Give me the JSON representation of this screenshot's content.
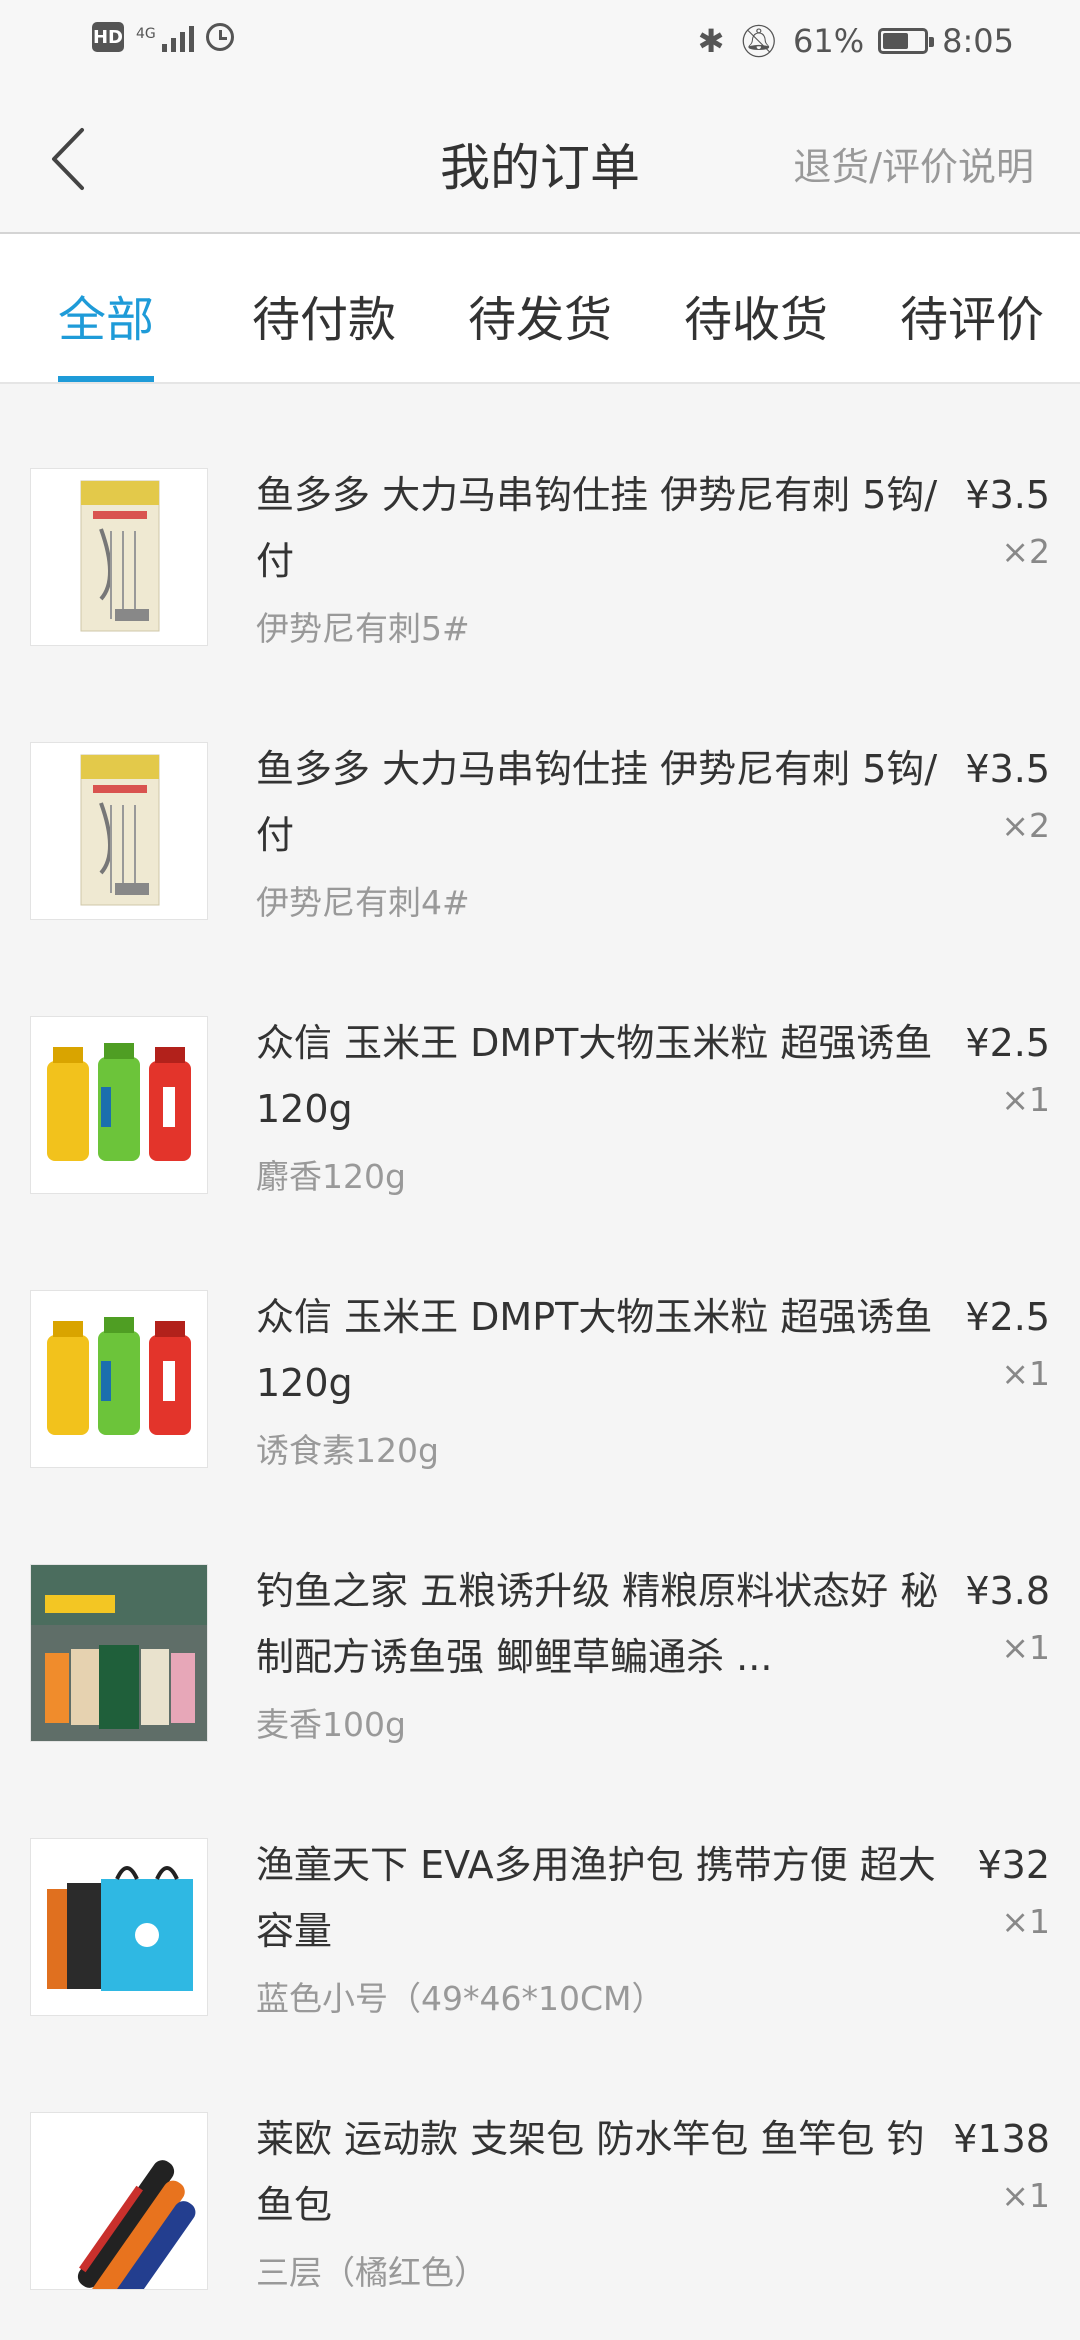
{
  "status_bar": {
    "hd": "HD",
    "network": "4G",
    "battery_percent": "61%",
    "battery_level": 0.61,
    "time": "8:05",
    "icons": [
      "bluetooth-icon",
      "mute-icon",
      "alarm-icon",
      "signal-icon"
    ]
  },
  "header": {
    "back_icon": "chevron-left-icon",
    "title": "我的订单",
    "help_link": "退货/评价说明"
  },
  "tabs": [
    {
      "label": "全部",
      "active": true
    },
    {
      "label": "待付款",
      "active": false
    },
    {
      "label": "待发货",
      "active": false
    },
    {
      "label": "待收货",
      "active": false
    },
    {
      "label": "待评价",
      "active": false
    }
  ],
  "colors": {
    "accent": "#1e9bd8",
    "background": "#f5f5f5",
    "text": "#333333",
    "muted": "#999999"
  },
  "orders": [
    {
      "title": "鱼多多 大力马串钩仕挂 伊势尼有刺 5钩/付",
      "spec": "伊势尼有刺5#",
      "price": "¥3.5",
      "qty": "×2",
      "thumb": "fishing-hook-pack"
    },
    {
      "title": "鱼多多 大力马串钩仕挂 伊势尼有刺 5钩/付",
      "spec": "伊势尼有刺4#",
      "price": "¥3.5",
      "qty": "×2",
      "thumb": "fishing-hook-pack"
    },
    {
      "title": "众信 玉米王 DMPT大物玉米粒 超强诱鱼 120g",
      "spec": "麝香120g",
      "price": "¥2.5",
      "qty": "×1",
      "thumb": "corn-bait-bottles"
    },
    {
      "title": "众信 玉米王 DMPT大物玉米粒 超强诱鱼 120g",
      "spec": "诱食素120g",
      "price": "¥2.5",
      "qty": "×1",
      "thumb": "corn-bait-bottles"
    },
    {
      "title": "钓鱼之家 五粮诱升级 精粮原料状态好 秘制配方诱鱼强 鲫鲤草鳊通杀 ...",
      "spec": "麦香100g",
      "price": "¥3.8",
      "qty": "×1",
      "thumb": "bait-powder-bags"
    },
    {
      "title": "渔童天下 EVA多用渔护包 携带方便 超大容量",
      "spec": "蓝色小号（49*46*10CM）",
      "price": "¥32",
      "qty": "×1",
      "thumb": "eva-fish-bags"
    },
    {
      "title": "莱欧 运动款 支架包 防水竿包 鱼竿包 钓鱼包",
      "spec": "三层（橘红色）",
      "price": "¥138",
      "qty": "×1",
      "thumb": "rod-bags"
    }
  ]
}
